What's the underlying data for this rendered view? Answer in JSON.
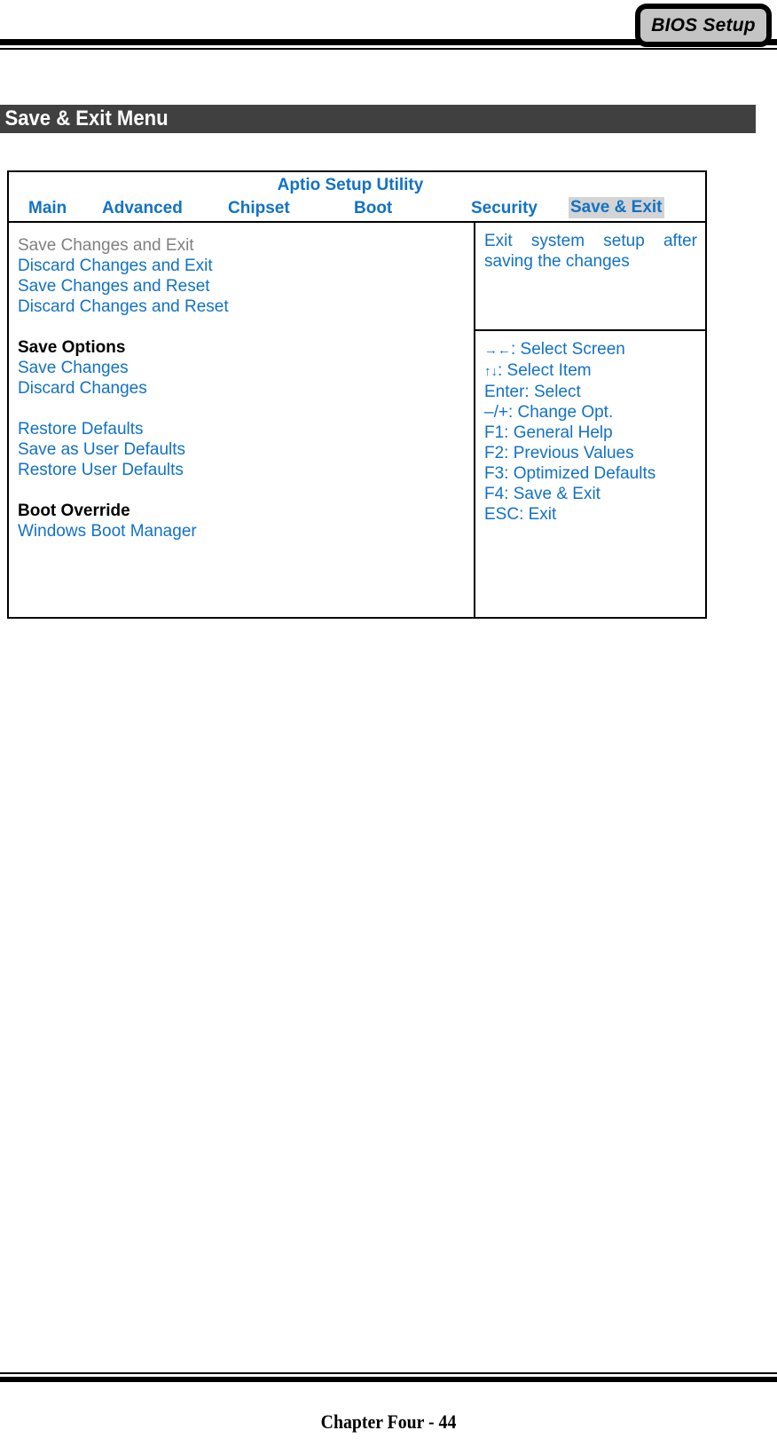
{
  "document": {
    "tab_badge": "BIOS Setup",
    "section_title": "Save & Exit Menu",
    "footer": "Chapter Four - 44"
  },
  "bios": {
    "utility_title": "Aptio Setup Utility",
    "tabs": [
      {
        "label": "Main",
        "active": false
      },
      {
        "label": "Advanced",
        "active": false
      },
      {
        "label": "Chipset",
        "active": false
      },
      {
        "label": "Boot",
        "active": false
      },
      {
        "label": "Security",
        "active": false
      },
      {
        "label": "Save & Exit",
        "active": true
      }
    ],
    "menu_items": [
      {
        "label": "Save Changes and Exit",
        "style": "dim"
      },
      {
        "label": "Discard Changes and Exit",
        "style": "link"
      },
      {
        "label": "Save Changes and Reset",
        "style": "link"
      },
      {
        "label": "Discard Changes and Reset",
        "style": "link"
      },
      {
        "label": "",
        "style": "spacer"
      },
      {
        "label": "Save Options",
        "style": "group"
      },
      {
        "label": "Save Changes",
        "style": "link"
      },
      {
        "label": "Discard Changes",
        "style": "link"
      },
      {
        "label": "",
        "style": "spacer"
      },
      {
        "label": "Restore Defaults",
        "style": "link"
      },
      {
        "label": "Save as User Defaults",
        "style": "link"
      },
      {
        "label": "Restore User Defaults",
        "style": "link"
      },
      {
        "label": "",
        "style": "spacer"
      },
      {
        "label": "Boot Override",
        "style": "group"
      },
      {
        "label": "Windows Boot Manager",
        "style": "link"
      }
    ],
    "help_text": "Exit system setup after saving the changes",
    "key_legend": [
      {
        "glyph": "→←",
        "text": ": Select Screen"
      },
      {
        "glyph": "↑↓",
        "text": ": Select Item"
      },
      {
        "glyph": "",
        "text": "Enter: Select"
      },
      {
        "glyph": "",
        "text": "–/+: Change Opt."
      },
      {
        "glyph": "",
        "text": "F1: General Help"
      },
      {
        "glyph": "",
        "text": "F2: Previous Values"
      },
      {
        "glyph": "",
        "text": "F3: Optimized Defaults"
      },
      {
        "glyph": "",
        "text": "F4: Save & Exit"
      },
      {
        "glyph": "",
        "text": "ESC: Exit"
      }
    ]
  },
  "colors": {
    "link_blue": "#1272c4",
    "dim_gray": "#808080",
    "tab_highlight": "#d4d4d4",
    "section_bar": "#404040",
    "badge_fill": "#c4c4c4"
  }
}
